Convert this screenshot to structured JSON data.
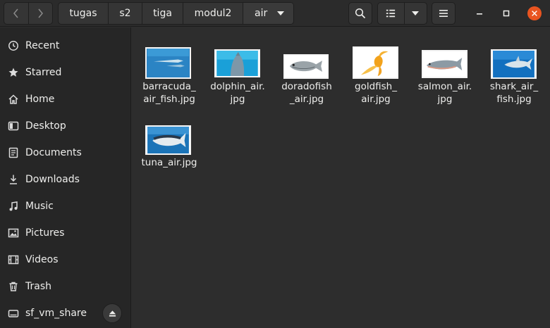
{
  "header": {
    "breadcrumbs": [
      "tugas",
      "s2",
      "tiga",
      "modul2",
      "air"
    ],
    "back_icon": "go-back-icon",
    "forward_icon": "go-forward-icon",
    "search_icon": "search-icon",
    "list_view_icon": "list-view-icon",
    "view_options_icon": "chevron-down-icon",
    "menu_icon": "hamburger-menu-icon",
    "minimize_icon": "minimize-icon",
    "maximize_icon": "maximize-icon",
    "close_icon": "close-icon",
    "close_color": "#e95420"
  },
  "sidebar": {
    "items": [
      {
        "label": "Recent",
        "icon": "clock-icon"
      },
      {
        "label": "Starred",
        "icon": "star-icon"
      },
      {
        "label": "Home",
        "icon": "home-icon"
      },
      {
        "label": "Desktop",
        "icon": "desktop-icon"
      },
      {
        "label": "Documents",
        "icon": "document-icon"
      },
      {
        "label": "Downloads",
        "icon": "download-icon"
      },
      {
        "label": "Music",
        "icon": "music-icon"
      },
      {
        "label": "Pictures",
        "icon": "picture-icon"
      },
      {
        "label": "Videos",
        "icon": "video-icon"
      },
      {
        "label": "Trash",
        "icon": "trash-icon"
      },
      {
        "label": "sf_vm_share",
        "icon": "drive-icon"
      }
    ],
    "eject_icon": "eject-icon"
  },
  "files": [
    {
      "name": "barracuda_\nair_fish.jpg",
      "thumb": "barracuda"
    },
    {
      "name": "dolphin_air.\njpg",
      "thumb": "dolphin"
    },
    {
      "name": "doradofish\n_air.jpg",
      "thumb": "dorado"
    },
    {
      "name": "goldfish_\nair.jpg",
      "thumb": "goldfish"
    },
    {
      "name": "salmon_air.\njpg",
      "thumb": "salmon"
    },
    {
      "name": "shark_air_\nfish.jpg",
      "thumb": "shark"
    },
    {
      "name": "tuna_air.jpg",
      "thumb": "tuna"
    }
  ]
}
